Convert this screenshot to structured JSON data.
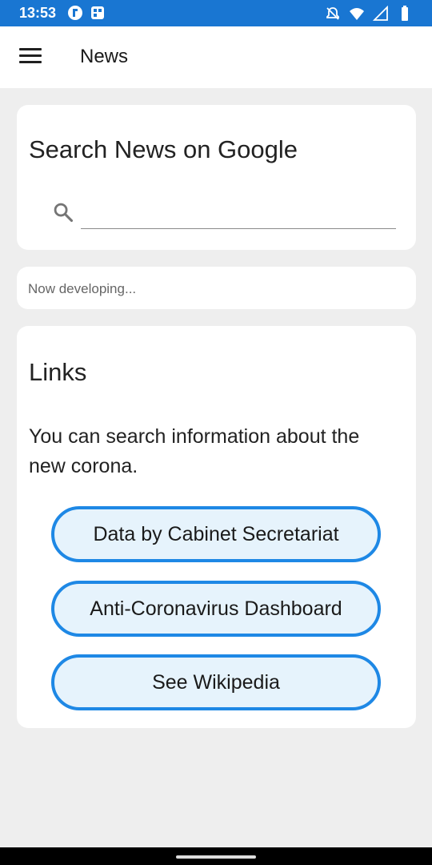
{
  "status_bar": {
    "time": "13:53",
    "icons_left": [
      "flipboard-icon",
      "app-icon"
    ],
    "icons_right": [
      "notifications-off-icon",
      "wifi-icon",
      "signal-icon",
      "battery-icon"
    ]
  },
  "app_bar": {
    "title": "News",
    "menu_icon": "hamburger-menu-icon"
  },
  "search_card": {
    "title": "Search News on Google",
    "input_value": "",
    "input_placeholder": ""
  },
  "status_card": {
    "text": "Now developing..."
  },
  "links_card": {
    "title": "Links",
    "description": "You can search information about the new corona.",
    "buttons": [
      {
        "label": "Data by Cabinet Secretariat"
      },
      {
        "label": "Anti-Coronavirus Dashboard"
      },
      {
        "label": "See Wikipedia"
      }
    ]
  },
  "colors": {
    "status_bar": "#1976d2",
    "button_border": "#1e88e5",
    "button_fill": "#e6f3fc",
    "background": "#eeeeee"
  }
}
